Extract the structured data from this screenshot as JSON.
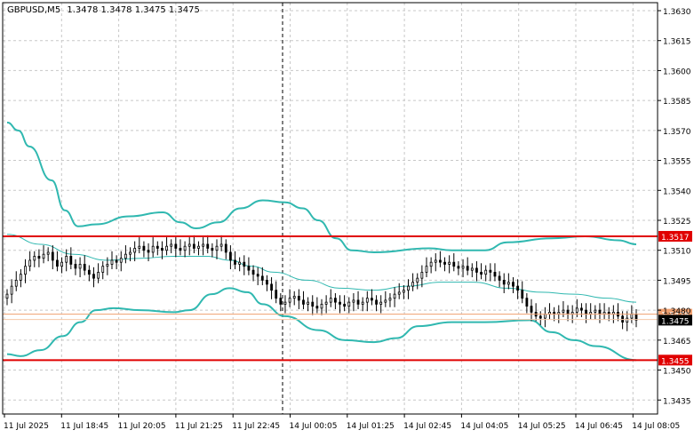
{
  "header": {
    "symbol_timeframe": "GBPUSD,M5",
    "ohlc": "1.3478 1.3478 1.3475 1.3475"
  },
  "colors": {
    "background": "#ffffff",
    "grid": "#c8c8c8",
    "axis": "#000000",
    "candle": "#000000",
    "bollinger": "#30b8b0",
    "level_line": "#e00000",
    "level_label_bg": "#e00000",
    "level_label_text": "#ffffff",
    "bid_line": "#f0a070",
    "price_label_bg": "#000000",
    "price_label_text": "#ffffff"
  },
  "chart_data": {
    "type": "candlestick",
    "ylim": [
      1.3428,
      1.3634
    ],
    "y_ticks": [
      "1.3630",
      "1.3615",
      "1.3600",
      "1.3585",
      "1.3570",
      "1.3555",
      "1.3540",
      "1.3525",
      "1.3510",
      "1.3495",
      "1.3480",
      "1.3465",
      "1.3450",
      "1.3435"
    ],
    "x_ticks": [
      "11 Jul 2025",
      "11 Jul 18:45",
      "11 Jul 20:05",
      "11 Jul 21:25",
      "11 Jul 22:45",
      "14 Jul 00:05",
      "14 Jul 01:25",
      "14 Jul 02:45",
      "14 Jul 04:05",
      "14 Jul 05:25",
      "14 Jul 06:45",
      "14 Jul 08:05"
    ],
    "closes": [
      1.3488,
      1.3492,
      1.3495,
      1.3498,
      1.3502,
      1.3505,
      1.3507,
      1.3506,
      1.3508,
      1.3509,
      1.3505,
      1.3502,
      1.3504,
      1.3507,
      1.3503,
      1.3501,
      1.3503,
      1.35,
      1.3498,
      1.3496,
      1.3499,
      1.3502,
      1.3503,
      1.3505,
      1.3504,
      1.3506,
      1.3508,
      1.3509,
      1.3511,
      1.3512,
      1.351,
      1.3509,
      1.3512,
      1.3511,
      1.351,
      1.3512,
      1.3513,
      1.3511,
      1.351,
      1.3512,
      1.3513,
      1.3511,
      1.3512,
      1.3513,
      1.3511,
      1.351,
      1.3512,
      1.3513,
      1.3509,
      1.3505,
      1.3503,
      1.3504,
      1.3502,
      1.35,
      1.3498,
      1.3497,
      1.3495,
      1.3493,
      1.349,
      1.3486,
      1.3483,
      1.3484,
      1.3486,
      1.3487,
      1.3485,
      1.3483,
      1.3484,
      1.3482,
      1.3481,
      1.3483,
      1.3484,
      1.3486,
      1.3484,
      1.3483,
      1.3482,
      1.3484,
      1.3485,
      1.3483,
      1.3484,
      1.3486,
      1.3485,
      1.3483,
      1.3484,
      1.3485,
      1.3486,
      1.3488,
      1.3489,
      1.349,
      1.3492,
      1.3494,
      1.3496,
      1.3499,
      1.3502,
      1.3504,
      1.3505,
      1.3504,
      1.3503,
      1.3504,
      1.3502,
      1.3501,
      1.3502,
      1.35,
      1.3501,
      1.3499,
      1.3498,
      1.35,
      1.3499,
      1.3497,
      1.3495,
      1.3493,
      1.3494,
      1.3492,
      1.349,
      1.3486,
      1.3482,
      1.3479,
      1.3477,
      1.3476,
      1.3478,
      1.3479,
      1.3478,
      1.3479,
      1.348,
      1.3478,
      1.3479,
      1.3481,
      1.348,
      1.3478,
      1.3479,
      1.348,
      1.3478,
      1.3479,
      1.3478,
      1.3479,
      1.3477,
      1.3474,
      1.3476,
      1.3478,
      1.3475
    ],
    "bollinger_upper": [
      [
        0,
        1.3574
      ],
      [
        5,
        1.357
      ],
      [
        10,
        1.3562
      ],
      [
        20,
        1.3545
      ],
      [
        26,
        1.353
      ],
      [
        32,
        1.3522
      ],
      [
        40,
        1.3523
      ],
      [
        55,
        1.3527
      ],
      [
        70,
        1.3529
      ],
      [
        78,
        1.3524
      ],
      [
        85,
        1.3521
      ],
      [
        95,
        1.3524
      ],
      [
        105,
        1.3531
      ],
      [
        115,
        1.3535
      ],
      [
        125,
        1.3534
      ],
      [
        133,
        1.3531
      ],
      [
        140,
        1.3525
      ],
      [
        148,
        1.3516
      ],
      [
        155,
        1.351
      ],
      [
        165,
        1.3509
      ],
      [
        190,
        1.3511
      ],
      [
        200,
        1.351
      ],
      [
        215,
        1.351
      ],
      [
        225,
        1.3514
      ],
      [
        245,
        1.3516
      ],
      [
        260,
        1.3517
      ],
      [
        275,
        1.3515
      ],
      [
        283,
        1.3513
      ]
    ],
    "bollinger_middle": [
      [
        0,
        1.3518
      ],
      [
        15,
        1.3513
      ],
      [
        30,
        1.3508
      ],
      [
        45,
        1.3505
      ],
      [
        60,
        1.3506
      ],
      [
        75,
        1.3507
      ],
      [
        90,
        1.3507
      ],
      [
        100,
        1.3505
      ],
      [
        110,
        1.3502
      ],
      [
        120,
        1.3499
      ],
      [
        135,
        1.3495
      ],
      [
        150,
        1.3491
      ],
      [
        165,
        1.349
      ],
      [
        180,
        1.3492
      ],
      [
        195,
        1.3494
      ],
      [
        210,
        1.3494
      ],
      [
        225,
        1.3491
      ],
      [
        240,
        1.3489
      ],
      [
        255,
        1.3488
      ],
      [
        270,
        1.3486
      ],
      [
        283,
        1.3484
      ]
    ],
    "bollinger_lower": [
      [
        0,
        1.3458
      ],
      [
        6,
        1.3457
      ],
      [
        15,
        1.346
      ],
      [
        25,
        1.3467
      ],
      [
        33,
        1.3474
      ],
      [
        40,
        1.348
      ],
      [
        48,
        1.3481
      ],
      [
        60,
        1.348
      ],
      [
        75,
        1.3479
      ],
      [
        82,
        1.348
      ],
      [
        92,
        1.3488
      ],
      [
        100,
        1.3491
      ],
      [
        108,
        1.3489
      ],
      [
        115,
        1.3483
      ],
      [
        125,
        1.3477
      ],
      [
        140,
        1.347
      ],
      [
        152,
        1.3465
      ],
      [
        165,
        1.3464
      ],
      [
        175,
        1.3466
      ],
      [
        185,
        1.3472
      ],
      [
        200,
        1.3474
      ],
      [
        215,
        1.3474
      ],
      [
        235,
        1.3475
      ],
      [
        245,
        1.3469
      ],
      [
        255,
        1.3465
      ],
      [
        265,
        1.3462
      ],
      [
        283,
        1.3455
      ]
    ],
    "levels": [
      {
        "value": 1.3517,
        "label": "1.3517"
      },
      {
        "value": 1.3455,
        "label": "1.3455"
      }
    ],
    "bid_line": {
      "value": 1.3478,
      "label": "1.3478"
    },
    "current_price": {
      "value": 1.3475,
      "label": "1.3475"
    },
    "session_separator_index": 128
  }
}
